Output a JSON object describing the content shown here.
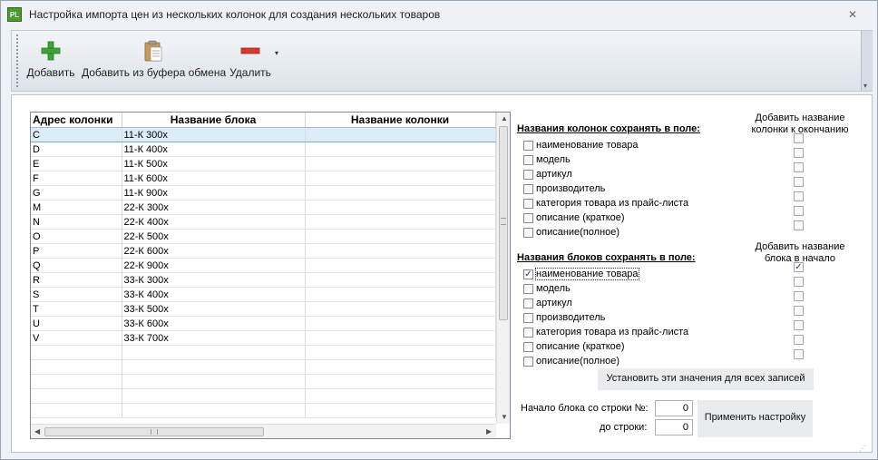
{
  "window": {
    "title": "Настройка импорта цен из нескольких колонок для создания нескольких товаров",
    "app_icon_text": "PL",
    "close_glyph": "✕"
  },
  "toolbar": {
    "add_label": "Добавить",
    "add_from_clipboard_label": "Добавить из буфера обмена",
    "delete_label": "Удалить",
    "icons": {
      "add": "plus-icon",
      "clipboard": "clipboard-icon",
      "delete": "minus-icon",
      "dropdown": "chevron-down-icon"
    },
    "colors": {
      "add": "#3fa535",
      "delete": "#d63a2f"
    }
  },
  "grid": {
    "columns": [
      "Адрес колонки",
      "Название блока",
      "Название колонки"
    ],
    "rows": [
      [
        "C",
        "11-К 300х",
        ""
      ],
      [
        "D",
        "11-К 400х",
        ""
      ],
      [
        "E",
        "11-К 500х",
        ""
      ],
      [
        "F",
        "11-К 600х",
        ""
      ],
      [
        "G",
        "11-К 900х",
        ""
      ],
      [
        "M",
        "22-К 300х",
        ""
      ],
      [
        "N",
        "22-К 400х",
        ""
      ],
      [
        "O",
        "22-К 500х",
        ""
      ],
      [
        "P",
        "22-К 600х",
        ""
      ],
      [
        "Q",
        "22-К 900х",
        ""
      ],
      [
        "R",
        "33-К 300х",
        ""
      ],
      [
        "S",
        "33-К 400х",
        ""
      ],
      [
        "T",
        "33-К 500х",
        ""
      ],
      [
        "U",
        "33-К 600х",
        ""
      ],
      [
        "V",
        "33-К 700х",
        ""
      ]
    ],
    "selected_row": 0,
    "empty_rows": 5
  },
  "column_names_section": {
    "title": "Названия колонок сохранять в поле:",
    "right_header": "Добавить название колонки к окончанию",
    "options": [
      {
        "label": "наименование товара",
        "checked": false,
        "append": false
      },
      {
        "label": "модель",
        "checked": false,
        "append": false
      },
      {
        "label": "артикул",
        "checked": false,
        "append": false
      },
      {
        "label": "производитель",
        "checked": false,
        "append": false
      },
      {
        "label": "категория товара из прайс-листа",
        "checked": false,
        "append": false
      },
      {
        "label": "описание (краткое)",
        "checked": false,
        "append": false
      },
      {
        "label": "описание(полное)",
        "checked": false,
        "append": false
      }
    ]
  },
  "block_names_section": {
    "title": "Названия блоков сохранять в поле:",
    "right_header": "Добавить название блока в начало",
    "options": [
      {
        "label": "наименование товара",
        "checked": true,
        "prepend": true
      },
      {
        "label": "модель",
        "checked": false,
        "prepend": false
      },
      {
        "label": "артикул",
        "checked": false,
        "prepend": false
      },
      {
        "label": "производитель",
        "checked": false,
        "prepend": false
      },
      {
        "label": "категория товара из прайс-листа",
        "checked": false,
        "prepend": false
      },
      {
        "label": "описание (краткое)",
        "checked": false,
        "prepend": false
      },
      {
        "label": "описание(полное)",
        "checked": false,
        "prepend": false
      }
    ]
  },
  "apply_all_button": "Установить эти значения для всех записей",
  "block_range": {
    "start_label": "Начало блока со строки №:",
    "start_value": "0",
    "end_label": "до строки:",
    "end_value": "0",
    "apply_button": "Применить настройку"
  }
}
